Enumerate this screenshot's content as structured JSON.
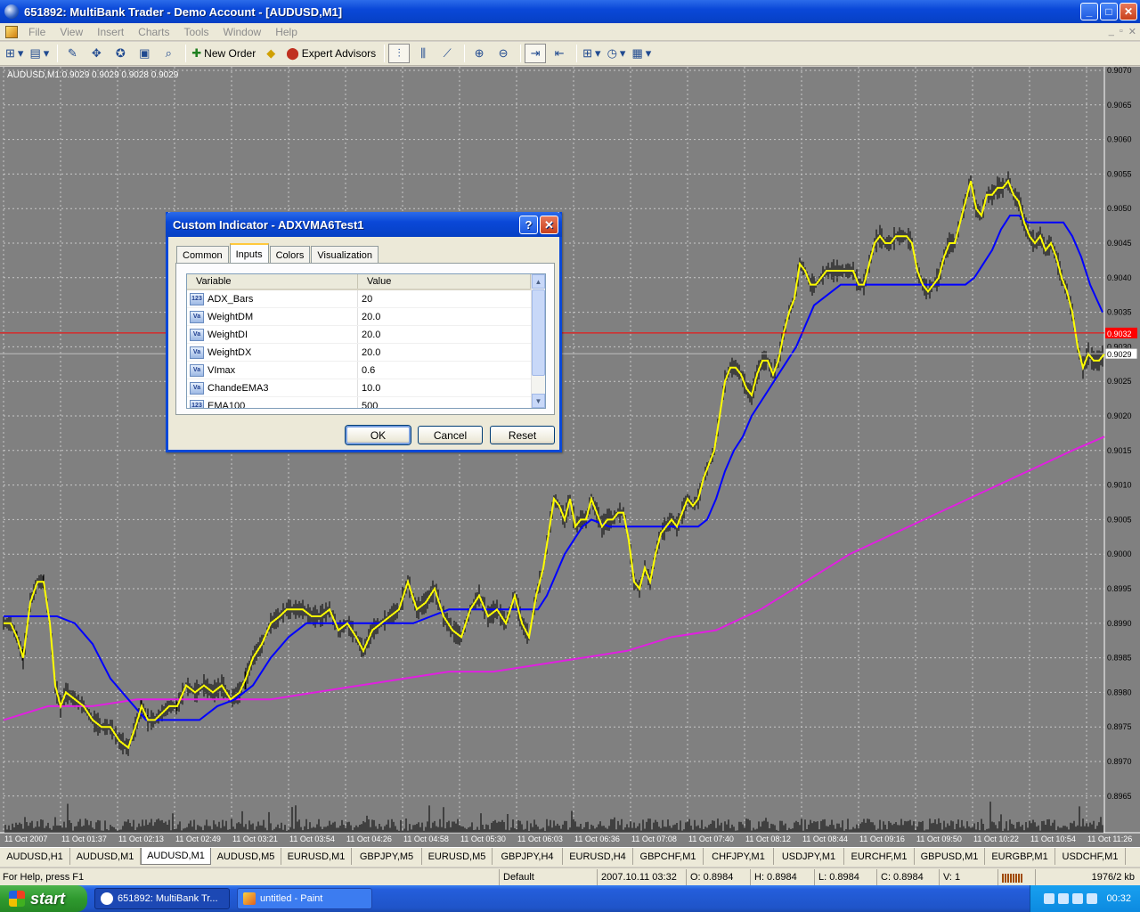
{
  "window": {
    "title": "651892: MultiBank Trader - Demo Account - [AUDUSD,M1]",
    "min": "_",
    "max": "□",
    "close": "✕"
  },
  "menu": {
    "items": [
      "File",
      "View",
      "Insert",
      "Charts",
      "Tools",
      "Window",
      "Help"
    ],
    "mdi": [
      "_",
      "▫",
      "✕"
    ]
  },
  "toolbar": {
    "new_order": "New Order",
    "expert_advisors": "Expert Advisors"
  },
  "chart": {
    "legend": "AUDUSD,M1  0.9029 0.9029 0.9028 0.9029",
    "price_labels": [
      "0.9070",
      "0.9065",
      "0.9060",
      "0.9055",
      "0.9050",
      "0.9045",
      "0.9040",
      "0.9035",
      "0.9030",
      "0.9025",
      "0.9020",
      "0.9015",
      "0.9010",
      "0.9005",
      "0.9000",
      "0.8995",
      "0.8990",
      "0.8985",
      "0.8980",
      "0.8975",
      "0.8970",
      "0.8965"
    ],
    "red_price": "0.9032",
    "current_price": "0.9029",
    "time_labels": [
      "11 Oct 2007",
      "11 Oct 01:37",
      "11 Oct 02:13",
      "11 Oct 02:49",
      "11 Oct 03:21",
      "11 Oct 03:54",
      "11 Oct 04:26",
      "11 Oct 04:58",
      "11 Oct 05:30",
      "11 Oct 06:03",
      "11 Oct 06:36",
      "11 Oct 07:08",
      "11 Oct 07:40",
      "11 Oct 08:12",
      "11 Oct 08:44",
      "11 Oct 09:16",
      "11 Oct 09:50",
      "11 Oct 10:22",
      "11 Oct 10:54",
      "11 Oct 11:26"
    ],
    "colors": {
      "bg": "#808080",
      "yellow": "#ffff00",
      "blue": "#0000ff",
      "magenta": "#e020e0",
      "red": "#ff0000",
      "grid": "#c8c8c8"
    },
    "yellow_line": [
      [
        0,
        0.899
      ],
      [
        8,
        0.899
      ],
      [
        15,
        0.8988
      ],
      [
        22,
        0.8985
      ],
      [
        30,
        0.8993
      ],
      [
        38,
        0.8996
      ],
      [
        45,
        0.8996
      ],
      [
        52,
        0.899
      ],
      [
        58,
        0.8981
      ],
      [
        64,
        0.8978
      ],
      [
        70,
        0.898
      ],
      [
        80,
        0.8979
      ],
      [
        90,
        0.8978
      ],
      [
        100,
        0.8976
      ],
      [
        110,
        0.8975
      ],
      [
        120,
        0.8975
      ],
      [
        130,
        0.8973
      ],
      [
        140,
        0.8972
      ],
      [
        148,
        0.8975
      ],
      [
        155,
        0.8978
      ],
      [
        162,
        0.8976
      ],
      [
        170,
        0.8976
      ],
      [
        178,
        0.8977
      ],
      [
        186,
        0.8978
      ],
      [
        195,
        0.8978
      ],
      [
        205,
        0.8981
      ],
      [
        215,
        0.898
      ],
      [
        225,
        0.8981
      ],
      [
        235,
        0.898
      ],
      [
        245,
        0.8981
      ],
      [
        255,
        0.8979
      ],
      [
        265,
        0.898
      ],
      [
        272,
        0.8982
      ],
      [
        280,
        0.8985
      ],
      [
        290,
        0.8987
      ],
      [
        300,
        0.899
      ],
      [
        310,
        0.8991
      ],
      [
        318,
        0.8992
      ],
      [
        326,
        0.8992
      ],
      [
        336,
        0.8992
      ],
      [
        346,
        0.8991
      ],
      [
        356,
        0.8991
      ],
      [
        366,
        0.8992
      ],
      [
        376,
        0.8989
      ],
      [
        386,
        0.899
      ],
      [
        396,
        0.8988
      ],
      [
        404,
        0.8986
      ],
      [
        414,
        0.8989
      ],
      [
        424,
        0.899
      ],
      [
        434,
        0.8991
      ],
      [
        444,
        0.8992
      ],
      [
        454,
        0.8996
      ],
      [
        464,
        0.8992
      ],
      [
        474,
        0.8993
      ],
      [
        484,
        0.8995
      ],
      [
        494,
        0.8991
      ],
      [
        504,
        0.8989
      ],
      [
        514,
        0.8988
      ],
      [
        524,
        0.8992
      ],
      [
        534,
        0.8994
      ],
      [
        544,
        0.8991
      ],
      [
        554,
        0.8992
      ],
      [
        564,
        0.899
      ],
      [
        574,
        0.8994
      ],
      [
        582,
        0.899
      ],
      [
        590,
        0.8988
      ],
      [
        598,
        0.8994
      ],
      [
        606,
        0.8998
      ],
      [
        612,
        0.9003
      ],
      [
        618,
        0.9008
      ],
      [
        624,
        0.9007
      ],
      [
        630,
        0.9005
      ],
      [
        636,
        0.9008
      ],
      [
        642,
        0.9004
      ],
      [
        648,
        0.9005
      ],
      [
        654,
        0.9005
      ],
      [
        660,
        0.9008
      ],
      [
        666,
        0.9006
      ],
      [
        672,
        0.9004
      ],
      [
        678,
        0.9005
      ],
      [
        684,
        0.9005
      ],
      [
        690,
        0.9006
      ],
      [
        696,
        0.9006
      ],
      [
        702,
        0.9002
      ],
      [
        708,
        0.8996
      ],
      [
        714,
        0.8995
      ],
      [
        720,
        0.8998
      ],
      [
        726,
        0.8996
      ],
      [
        732,
        0.9
      ],
      [
        738,
        0.9003
      ],
      [
        744,
        0.9004
      ],
      [
        750,
        0.9005
      ],
      [
        756,
        0.9004
      ],
      [
        762,
        0.9006
      ],
      [
        768,
        0.9008
      ],
      [
        774,
        0.9007
      ],
      [
        780,
        0.9008
      ],
      [
        786,
        0.9011
      ],
      [
        792,
        0.9013
      ],
      [
        798,
        0.9015
      ],
      [
        804,
        0.902
      ],
      [
        810,
        0.9025
      ],
      [
        816,
        0.9027
      ],
      [
        822,
        0.9027
      ],
      [
        828,
        0.9026
      ],
      [
        834,
        0.9024
      ],
      [
        840,
        0.9023
      ],
      [
        846,
        0.9026
      ],
      [
        852,
        0.9028
      ],
      [
        858,
        0.9028
      ],
      [
        864,
        0.9026
      ],
      [
        870,
        0.9028
      ],
      [
        876,
        0.9032
      ],
      [
        882,
        0.9035
      ],
      [
        888,
        0.9037
      ],
      [
        894,
        0.9042
      ],
      [
        900,
        0.9041
      ],
      [
        906,
        0.9039
      ],
      [
        912,
        0.9039
      ],
      [
        918,
        0.904
      ],
      [
        924,
        0.9041
      ],
      [
        930,
        0.9041
      ],
      [
        936,
        0.9041
      ],
      [
        942,
        0.9041
      ],
      [
        948,
        0.9041
      ],
      [
        954,
        0.9041
      ],
      [
        960,
        0.9039
      ],
      [
        966,
        0.9039
      ],
      [
        972,
        0.9042
      ],
      [
        978,
        0.9045
      ],
      [
        984,
        0.9046
      ],
      [
        990,
        0.9045
      ],
      [
        996,
        0.9045
      ],
      [
        1002,
        0.9046
      ],
      [
        1008,
        0.9046
      ],
      [
        1014,
        0.9046
      ],
      [
        1020,
        0.9045
      ],
      [
        1026,
        0.9041
      ],
      [
        1032,
        0.9039
      ],
      [
        1038,
        0.9038
      ],
      [
        1044,
        0.9039
      ],
      [
        1050,
        0.904
      ],
      [
        1056,
        0.9043
      ],
      [
        1062,
        0.9045
      ],
      [
        1068,
        0.9045
      ],
      [
        1074,
        0.9048
      ],
      [
        1080,
        0.9051
      ],
      [
        1086,
        0.9054
      ],
      [
        1092,
        0.905
      ],
      [
        1098,
        0.9049
      ],
      [
        1104,
        0.9052
      ],
      [
        1110,
        0.9052
      ],
      [
        1116,
        0.9053
      ],
      [
        1122,
        0.9053
      ],
      [
        1128,
        0.9054
      ],
      [
        1134,
        0.9052
      ],
      [
        1140,
        0.9051
      ],
      [
        1146,
        0.9048
      ],
      [
        1152,
        0.9046
      ],
      [
        1158,
        0.9045
      ],
      [
        1164,
        0.9046
      ],
      [
        1170,
        0.9044
      ],
      [
        1176,
        0.9045
      ],
      [
        1182,
        0.9043
      ],
      [
        1188,
        0.904
      ],
      [
        1194,
        0.9038
      ],
      [
        1200,
        0.9035
      ],
      [
        1206,
        0.903
      ],
      [
        1212,
        0.9027
      ],
      [
        1218,
        0.9029
      ],
      [
        1224,
        0.9028
      ],
      [
        1230,
        0.9028
      ],
      [
        1236,
        0.9029
      ]
    ],
    "blue_line": [
      [
        0,
        0.8991
      ],
      [
        20,
        0.8991
      ],
      [
        40,
        0.8991
      ],
      [
        60,
        0.8991
      ],
      [
        80,
        0.899
      ],
      [
        100,
        0.8987
      ],
      [
        120,
        0.8982
      ],
      [
        140,
        0.8979
      ],
      [
        160,
        0.8976
      ],
      [
        180,
        0.8976
      ],
      [
        200,
        0.8976
      ],
      [
        220,
        0.8976
      ],
      [
        240,
        0.8978
      ],
      [
        260,
        0.8979
      ],
      [
        280,
        0.8981
      ],
      [
        300,
        0.8985
      ],
      [
        320,
        0.8988
      ],
      [
        340,
        0.899
      ],
      [
        360,
        0.899
      ],
      [
        380,
        0.899
      ],
      [
        400,
        0.899
      ],
      [
        420,
        0.899
      ],
      [
        440,
        0.899
      ],
      [
        460,
        0.899
      ],
      [
        480,
        0.8991
      ],
      [
        500,
        0.8992
      ],
      [
        520,
        0.8992
      ],
      [
        540,
        0.8992
      ],
      [
        560,
        0.8992
      ],
      [
        580,
        0.8992
      ],
      [
        600,
        0.8992
      ],
      [
        610,
        0.8994
      ],
      [
        620,
        0.8997
      ],
      [
        630,
        0.9
      ],
      [
        640,
        0.9002
      ],
      [
        650,
        0.9004
      ],
      [
        660,
        0.9005
      ],
      [
        680,
        0.9004
      ],
      [
        700,
        0.9004
      ],
      [
        720,
        0.9004
      ],
      [
        740,
        0.9004
      ],
      [
        760,
        0.9004
      ],
      [
        780,
        0.9004
      ],
      [
        790,
        0.9005
      ],
      [
        800,
        0.9008
      ],
      [
        810,
        0.9012
      ],
      [
        820,
        0.9015
      ],
      [
        830,
        0.9017
      ],
      [
        840,
        0.902
      ],
      [
        850,
        0.9022
      ],
      [
        860,
        0.9024
      ],
      [
        870,
        0.9026
      ],
      [
        880,
        0.9028
      ],
      [
        890,
        0.903
      ],
      [
        900,
        0.9033
      ],
      [
        910,
        0.9036
      ],
      [
        920,
        0.9037
      ],
      [
        930,
        0.9038
      ],
      [
        940,
        0.9039
      ],
      [
        950,
        0.9039
      ],
      [
        960,
        0.9039
      ],
      [
        980,
        0.9039
      ],
      [
        1000,
        0.9039
      ],
      [
        1020,
        0.9039
      ],
      [
        1040,
        0.9039
      ],
      [
        1060,
        0.9039
      ],
      [
        1080,
        0.9039
      ],
      [
        1090,
        0.904
      ],
      [
        1100,
        0.9042
      ],
      [
        1110,
        0.9044
      ],
      [
        1120,
        0.9047
      ],
      [
        1130,
        0.9049
      ],
      [
        1140,
        0.9049
      ],
      [
        1150,
        0.9048
      ],
      [
        1170,
        0.9048
      ],
      [
        1190,
        0.9048
      ],
      [
        1200,
        0.9046
      ],
      [
        1210,
        0.9043
      ],
      [
        1220,
        0.9039
      ],
      [
        1234,
        0.9035
      ]
    ],
    "magenta_line": [
      [
        0,
        0.8976
      ],
      [
        50,
        0.8978
      ],
      [
        100,
        0.8978
      ],
      [
        150,
        0.8979
      ],
      [
        200,
        0.8979
      ],
      [
        250,
        0.8979
      ],
      [
        300,
        0.8979
      ],
      [
        350,
        0.898
      ],
      [
        400,
        0.8981
      ],
      [
        450,
        0.8982
      ],
      [
        500,
        0.8983
      ],
      [
        550,
        0.8983
      ],
      [
        600,
        0.8984
      ],
      [
        650,
        0.8985
      ],
      [
        700,
        0.8986
      ],
      [
        750,
        0.8988
      ],
      [
        800,
        0.8989
      ],
      [
        850,
        0.8992
      ],
      [
        900,
        0.8996
      ],
      [
        950,
        0.9
      ],
      [
        1000,
        0.9003
      ],
      [
        1050,
        0.9006
      ],
      [
        1100,
        0.9009
      ],
      [
        1150,
        0.9012
      ],
      [
        1200,
        0.9015
      ],
      [
        1236,
        0.9017
      ]
    ]
  },
  "tabs": [
    "AUDUSD,H1",
    "AUDUSD,M1",
    "AUDUSD,M1",
    "AUDUSD,M5",
    "EURUSD,M1",
    "GBPJPY,M5",
    "EURUSD,M5",
    "GBPJPY,H4",
    "EURUSD,H4",
    "GBPCHF,M1",
    "CHFJPY,M1",
    "USDJPY,M1",
    "EURCHF,M1",
    "GBPUSD,M1",
    "EURGBP,M1",
    "USDCHF,M1"
  ],
  "status": {
    "help": "For Help, press F1",
    "profile": "Default",
    "datetime": "2007.10.11 03:32",
    "open": "O: 0.8984",
    "high": "H: 0.8984",
    "low": "L: 0.8984",
    "close": "C: 0.8984",
    "volume": "V: 1",
    "traffic": "1976/2 kb"
  },
  "taskbar": {
    "start": "start",
    "items": [
      "651892: MultiBank Tr...",
      "untitled - Paint"
    ],
    "clock": "00:32"
  },
  "dialog": {
    "title": "Custom Indicator - ADXVMA6Test1",
    "help": "?",
    "close": "✕",
    "tabs": [
      "Common",
      "Inputs",
      "Colors",
      "Visualization"
    ],
    "columns": [
      "Variable",
      "Value"
    ],
    "rows": [
      {
        "type": "123",
        "name": "ADX_Bars",
        "value": "20"
      },
      {
        "type": "Va",
        "name": "WeightDM",
        "value": "20.0"
      },
      {
        "type": "Va",
        "name": "WeightDI",
        "value": "20.0"
      },
      {
        "type": "Va",
        "name": "WeightDX",
        "value": "20.0"
      },
      {
        "type": "Va",
        "name": "VImax",
        "value": "0.6"
      },
      {
        "type": "Va",
        "name": "ChandeEMA3",
        "value": "10.0"
      },
      {
        "type": "123",
        "name": "EMA100",
        "value": "500"
      }
    ],
    "ok": "OK",
    "cancel": "Cancel",
    "reset": "Reset"
  }
}
